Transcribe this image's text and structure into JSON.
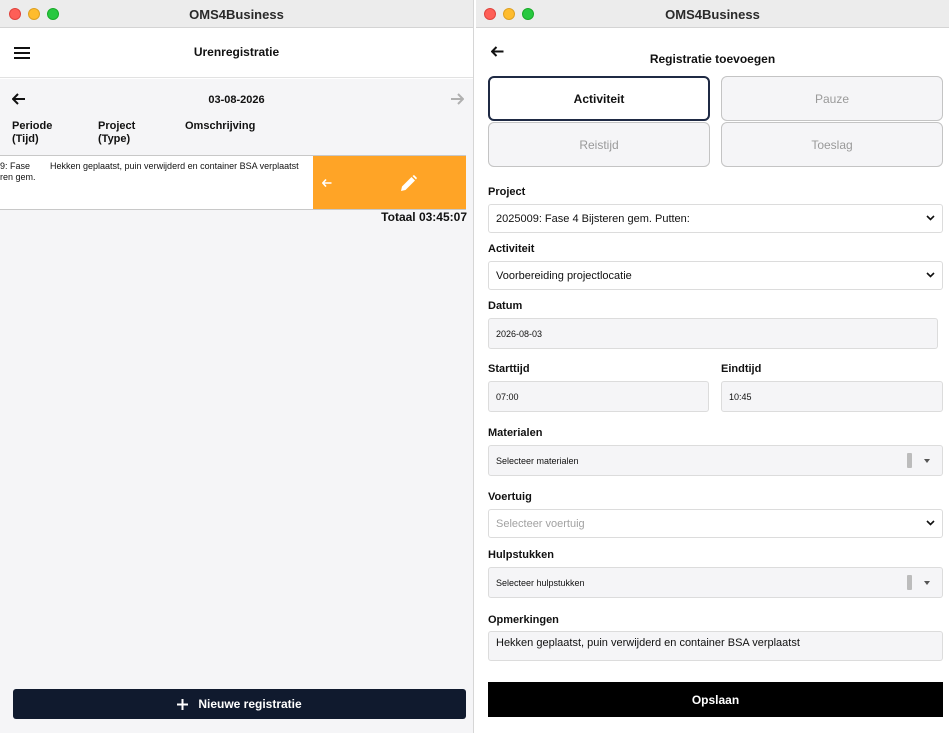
{
  "left_window": {
    "title": "OMS4Business",
    "appbar": {
      "menu_icon": "hamburger-menu-icon",
      "title": "Urenregistratie"
    },
    "date_nav": {
      "date": "03-08-2026",
      "prev_icon": "arrow-left-icon",
      "next_icon": "arrow-right-icon"
    },
    "columns": [
      {
        "line1": "Periode",
        "line2": "(Tijd)"
      },
      {
        "line1": "Project",
        "line2": "(Type)"
      },
      {
        "line1": "Omschrijving",
        "line2": ""
      }
    ],
    "entry": {
      "project_line1": "9: Fase",
      "project_line2": "ren gem.",
      "description": "Hekken geplaatst, puin verwijderd en container BSA verplaatst",
      "actions": [
        "arrow-left-icon",
        "pencil-icon"
      ],
      "action_color": "#ffa426"
    },
    "total": "Totaal 03:45:07",
    "new_button": {
      "icon": "plus-icon",
      "label": "Nieuwe registratie"
    }
  },
  "right_window": {
    "title": "OMS4Business",
    "appbar": {
      "back_icon": "arrow-left-icon",
      "title": "Registratie toevoegen"
    },
    "segments": [
      {
        "label": "Activiteit",
        "selected": true
      },
      {
        "label": "Pauze",
        "selected": false
      },
      {
        "label": "Reistijd",
        "selected": false
      },
      {
        "label": "Toeslag",
        "selected": false
      }
    ],
    "form": {
      "project": {
        "label": "Project",
        "value": "2025009: Fase 4 Bijsteren gem. Putten:"
      },
      "activity": {
        "label": "Activiteit",
        "value": "Voorbereiding projectlocatie"
      },
      "date": {
        "label": "Datum",
        "value": "2026-08-03"
      },
      "start": {
        "label": "Starttijd",
        "value": "07:00"
      },
      "end": {
        "label": "Eindtijd",
        "value": "10:45"
      },
      "materials": {
        "label": "Materialen",
        "placeholder": "Selecteer materialen"
      },
      "vehicle": {
        "label": "Voertuig",
        "placeholder": "Selecteer voertuig"
      },
      "attachments": {
        "label": "Hulpstukken",
        "placeholder": "Selecteer hulpstukken"
      },
      "remarks": {
        "label": "Opmerkingen",
        "value": "Hekken geplaatst, puin verwijderd en container BSA verplaatst"
      }
    },
    "save_button": {
      "label": "Opslaan"
    }
  },
  "colors": {
    "primary_dark": "#101a2e",
    "save_black": "#000000",
    "swipe_orange": "#ffa426",
    "background_grey": "#f5f5f7"
  }
}
